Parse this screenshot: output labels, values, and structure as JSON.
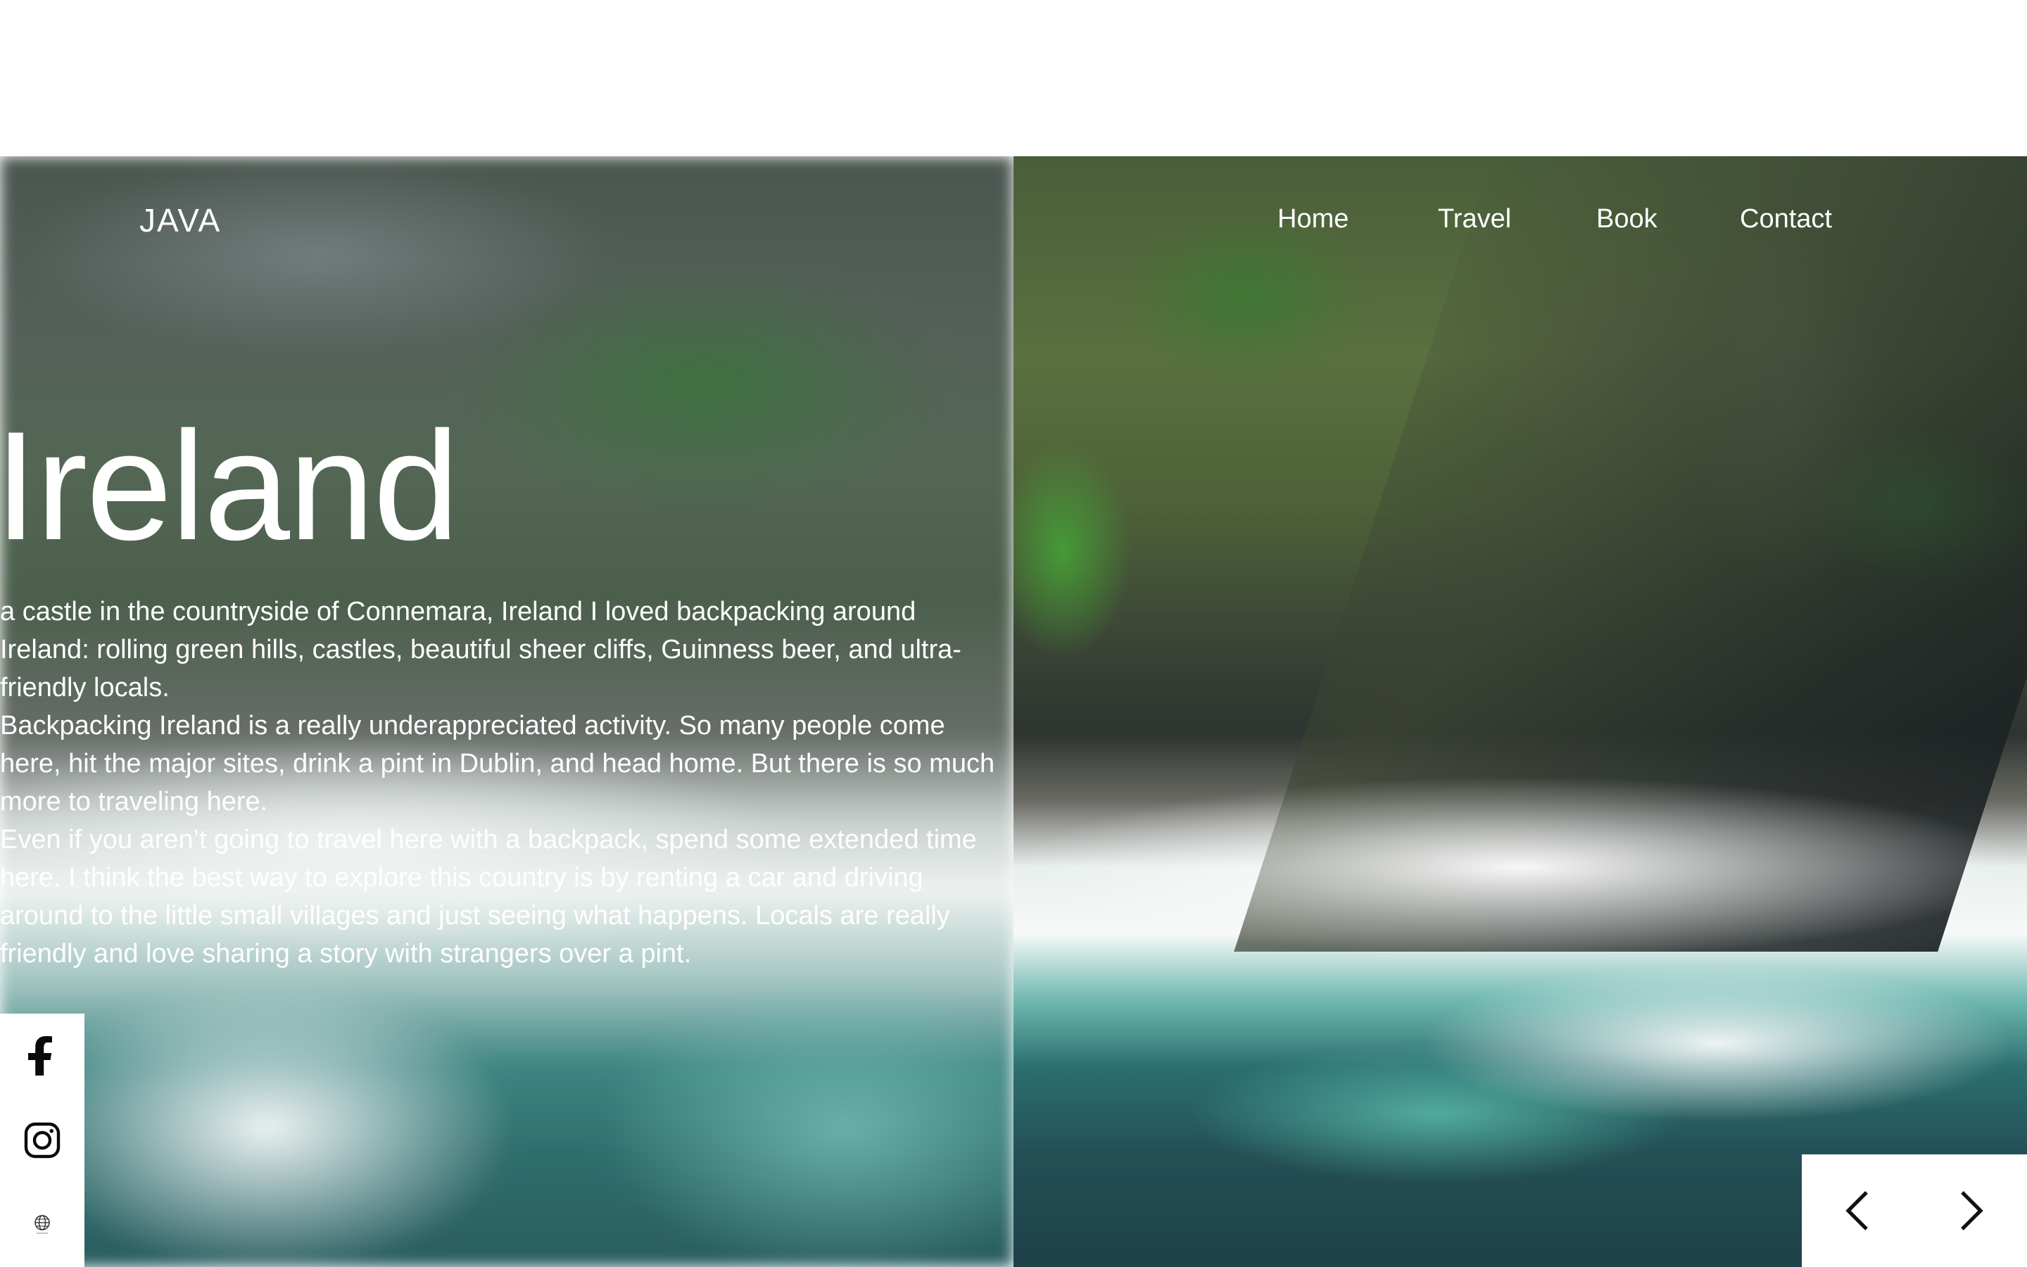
{
  "header": {
    "brand": "JAVA",
    "nav": [
      "Home",
      "Travel",
      "Book",
      "Contact"
    ]
  },
  "hero": {
    "title": "Ireland",
    "paragraphs": [
      "a castle in the countryside of Connemara, Ireland I loved backpacking around Ireland: rolling green hills, castles, beautiful sheer cliffs, Guinness beer, and ultra-friendly locals.",
      "Backpacking Ireland is a really underappreciated activity. So many people come here, hit the major sites, drink a pint in Dublin, and head home. But there is so much more to traveling here.",
      "Even if you aren’t going to travel here with a backpack, spend some extended time here. I think the best way to explore this country is by renting a car and driving around to the little small villages and just seeing what happens. Locals are really friendly and love sharing a story with strangers over a pint."
    ]
  },
  "social": {
    "icons": [
      "facebook-icon",
      "instagram-icon",
      "globe-icon"
    ]
  },
  "slider": {
    "icons": [
      "chevron-left-icon",
      "chevron-right-icon"
    ]
  }
}
